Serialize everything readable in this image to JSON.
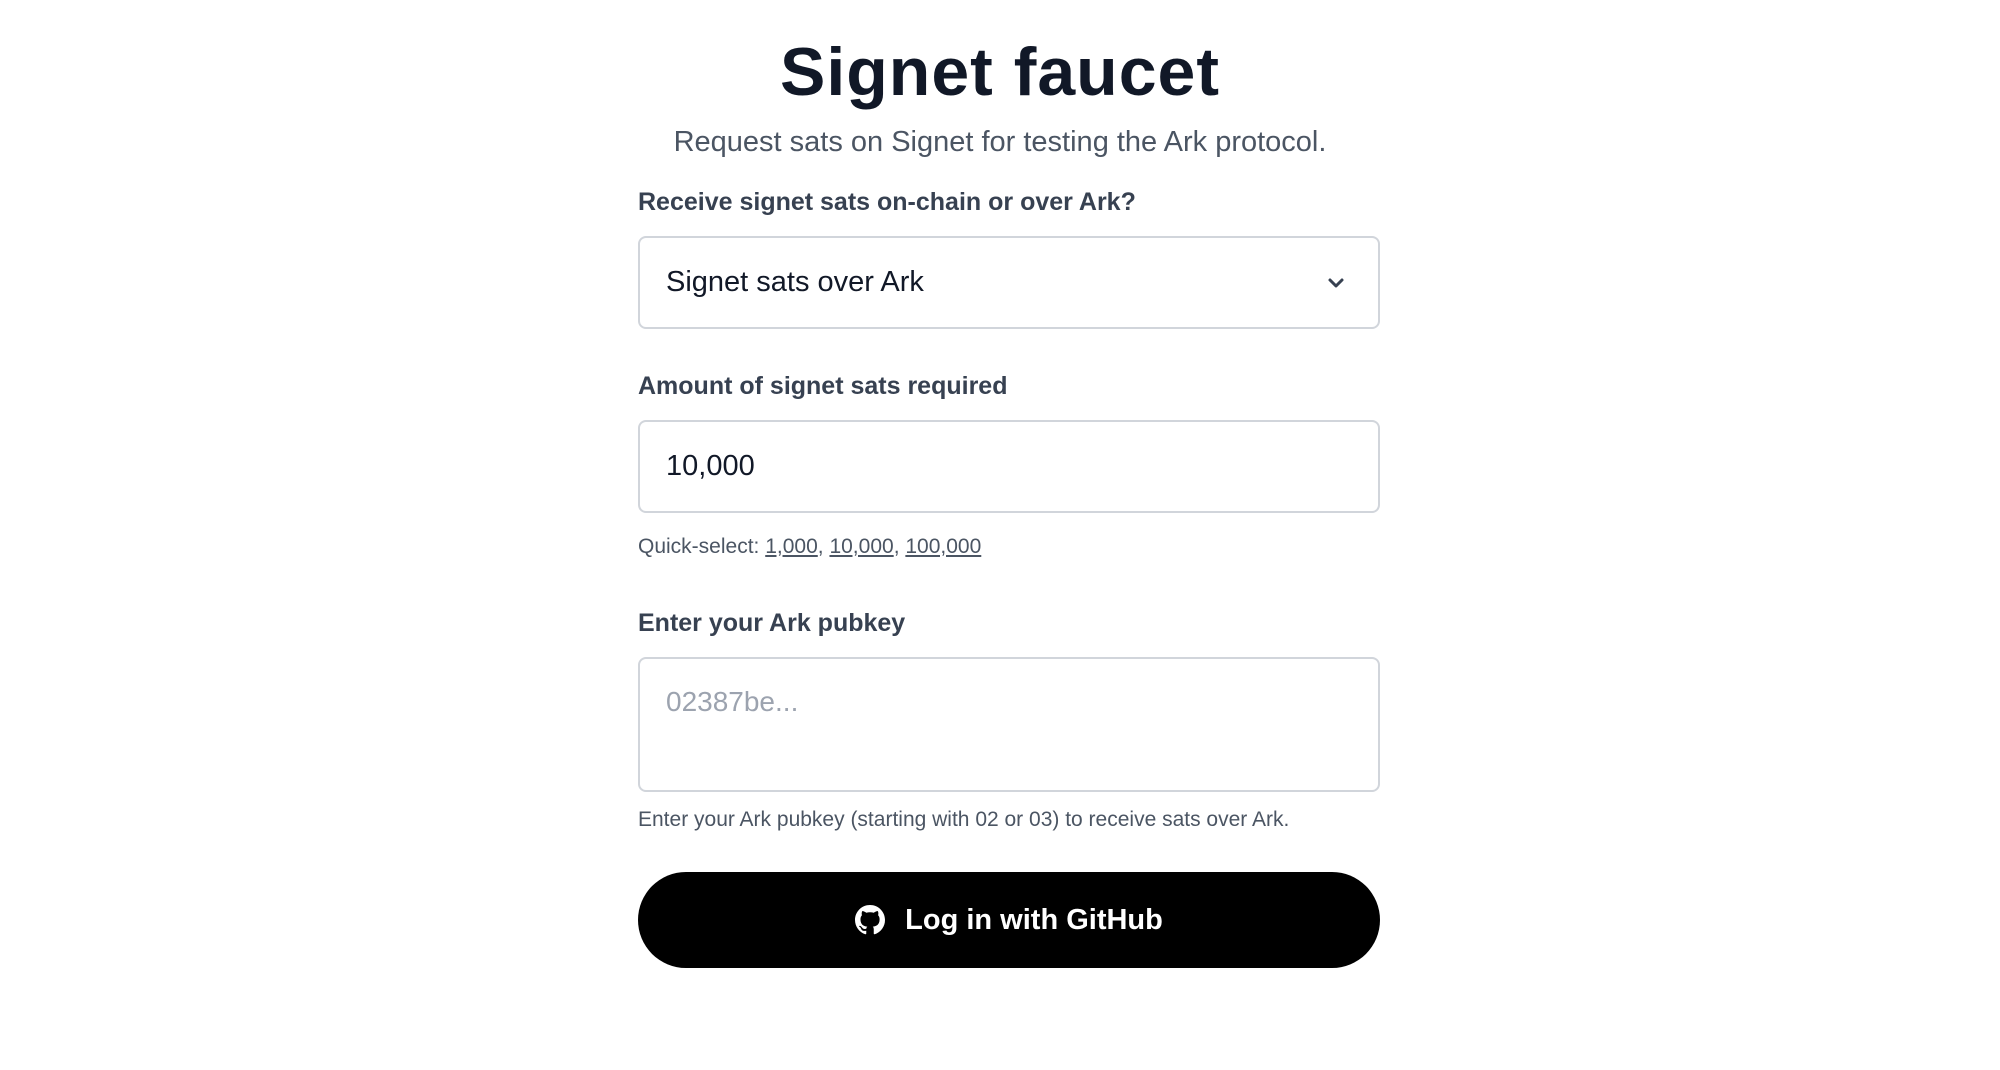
{
  "header": {
    "title": "Signet faucet",
    "subtitle": "Request sats on Signet for testing the Ark protocol."
  },
  "receive_method": {
    "label": "Receive signet sats on-chain or over Ark?",
    "selected": "Signet sats over Ark",
    "icon": "chevron-down-icon"
  },
  "amount": {
    "label": "Amount of signet sats required",
    "value": "10,000",
    "quick_select_label": "Quick-select:",
    "quick_select_options": [
      "1,000",
      "10,000",
      "100,000"
    ]
  },
  "pubkey": {
    "label": "Enter your Ark pubkey",
    "placeholder": "02387be...",
    "help": "Enter your Ark pubkey (starting with 02 or 03) to receive sats over Ark."
  },
  "login_button": {
    "label": "Log in with GitHub",
    "icon": "github-icon"
  },
  "colors": {
    "primary_button": "#000000",
    "border": "#d1d5db",
    "text": "#111827",
    "muted_text": "#4b5563",
    "placeholder": "#9ca3af"
  }
}
